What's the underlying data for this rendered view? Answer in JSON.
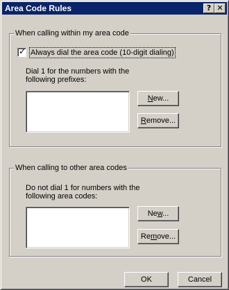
{
  "window": {
    "title": "Area Code Rules",
    "help_glyph": "?",
    "close_glyph": "✕"
  },
  "group_within": {
    "caption": "When calling within my area code",
    "checkbox": {
      "label": "Always dial the area code (10-digit dialing)",
      "checked": true
    },
    "description_line1": "Dial 1 for the numbers with the",
    "description_line2": "following prefixes:",
    "new_button": {
      "pre": "",
      "u": "N",
      "post": "ew..."
    },
    "remove_button": {
      "pre": "",
      "u": "R",
      "post": "emove..."
    }
  },
  "group_other": {
    "caption": "When calling to other area codes",
    "description_line1": "Do not dial 1 for numbers with the",
    "description_line2": "following area codes:",
    "new_button": {
      "pre": "Ne",
      "u": "w",
      "post": "..."
    },
    "remove_button": {
      "pre": "Re",
      "u": "m",
      "post": "ove..."
    }
  },
  "footer": {
    "ok_label": "OK",
    "cancel_label": "Cancel"
  },
  "colors": {
    "title_bar": "#0a246a",
    "dialog_face": "#d4d0c8"
  }
}
